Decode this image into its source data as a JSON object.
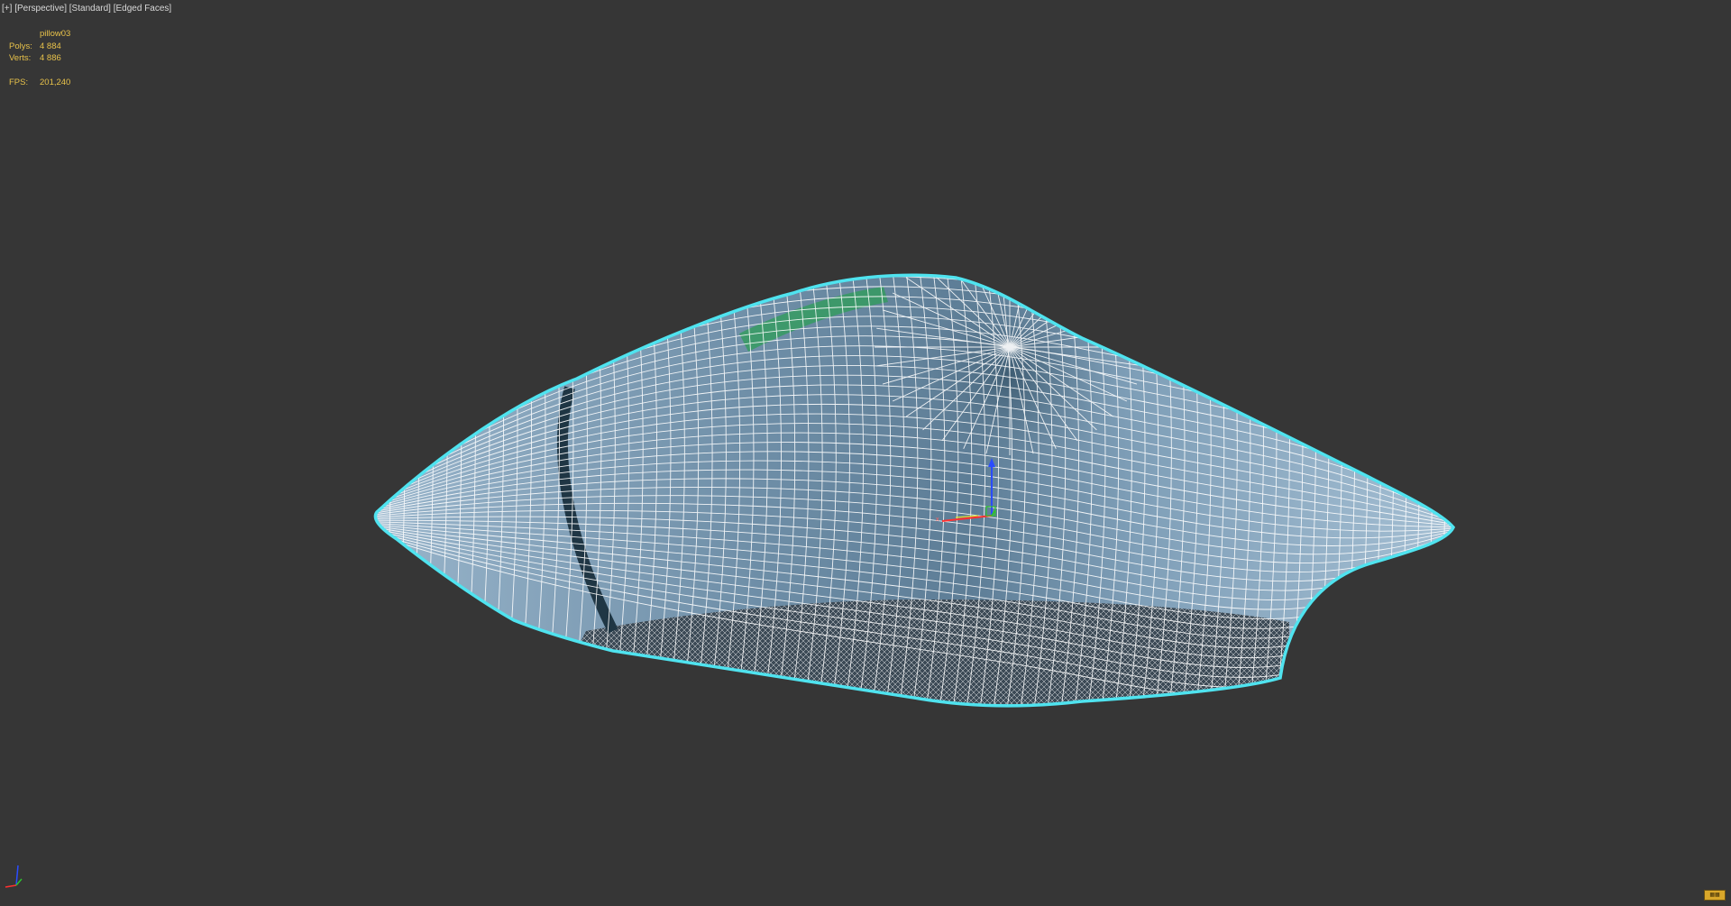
{
  "viewport": {
    "label_plus": "[+]",
    "label_view": "[Perspective]",
    "label_shading": "[Standard]",
    "label_edged": "[Edged Faces]"
  },
  "stats": {
    "object_name": "pillow03",
    "polys_label": "Polys:",
    "polys_value": "4 884",
    "verts_label": "Verts:",
    "verts_value": "4 886",
    "fps_label": "FPS:",
    "fps_value": "201,240"
  },
  "scene": {
    "background_color": "#363636",
    "mesh_fill_color": "#7f9fb8",
    "wire_color": "#ffffff",
    "selection_outline_color": "#4fe3ef",
    "gizmo_x_color": "#ff3030",
    "gizmo_y_color": "#2ec22e",
    "gizmo_z_color": "#2a4cff"
  },
  "icons": {
    "viewcube": "axis-tripod-icon",
    "corner": "viewport-layout-icon"
  }
}
